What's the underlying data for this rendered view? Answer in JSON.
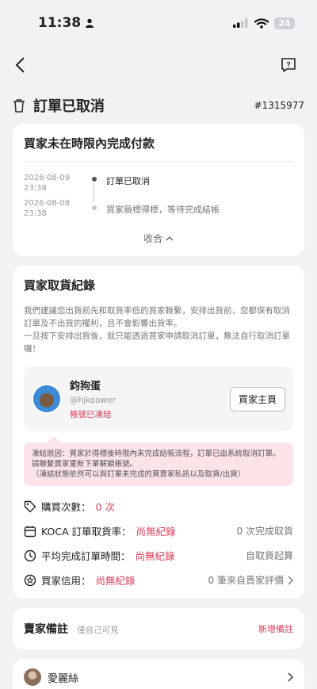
{
  "status_bar": {
    "time": "11:38",
    "battery": "24"
  },
  "order": {
    "title": "訂單已取消",
    "number": "#1315977"
  },
  "cancel_card": {
    "title": "買家未在時限內完成付款",
    "timeline": [
      {
        "date": "2026-08-09",
        "time": "23:38",
        "text": "訂單已取消"
      },
      {
        "date": "2026-08-08",
        "time": "23:38",
        "text": "買家競標得標，等待完成結帳"
      }
    ],
    "collapse_label": "收合",
    "colors": {
      "active_dot": "#555555",
      "inactive_dot": "#c8c8c8"
    }
  },
  "pickup": {
    "title": "買家取貨紀錄",
    "desc1": "我們建議您出貨前先和取貨率低的買家聯繫，安排出貨前，您都保有取消訂單及不出貨的權利，且不會影響出貨率。",
    "desc2": "一旦按下安排出貨後，就只能透過買家申請取消訂單，無法自行取消訂單囉！",
    "buyer": {
      "name": "鈞狗蛋",
      "handle": "@hjkoower",
      "frozen": "帳號已凍結",
      "home_button": "買家主頁"
    },
    "freeze_note": "凍結原因：買家於得標後時限內未完成結帳流程，訂單已由系統取消訂單。請聯繫賣家重新下單解鎖帳號。\n（凍結狀態依然可以與訂單未完成的買賣家私訊以及取貨/出貨）",
    "stats": {
      "purchase_label": "購買次數：",
      "purchase_value": "0 次",
      "rate_label": "KOCA 訂單取貨率：",
      "rate_value": "尚無紀錄",
      "rate_right": "0 次完成取貨",
      "time_label": "平均完成訂單時間：",
      "time_value": "尚無紀錄",
      "time_right": "自取貨起算",
      "credit_label": "買家信用：",
      "credit_value": "尚無紀錄",
      "credit_right": "0 筆來自賣家評價"
    }
  },
  "seller_note": {
    "title": "賣家備註",
    "subtitle": "僅自己可見",
    "add_label": "新增備註"
  },
  "user_card": {
    "name": "愛麗絲"
  },
  "accent_color": "#e0405e"
}
